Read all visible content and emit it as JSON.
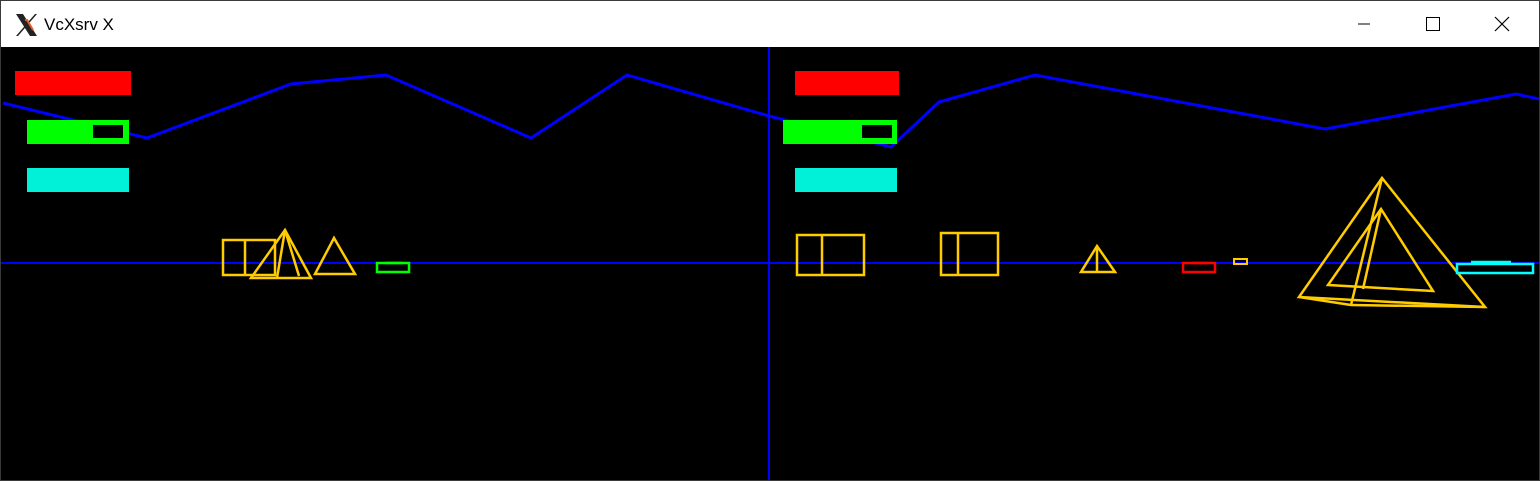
{
  "window": {
    "title": "VcXsrv X",
    "icon": "x-logo-icon",
    "controls": [
      "minimize-icon",
      "maximize-icon",
      "close-icon"
    ]
  },
  "colors": {
    "titlebar_bg": "#ffffff",
    "viewport_bg": "#000000",
    "horizon": "#0000ff",
    "mountains": "#0000ff",
    "objects": "#ffcc00",
    "bar_red": "#ff0000",
    "bar_green": "#00ff00",
    "bar_cyan": "#00f0d8",
    "player_tank_left": "#00ff00",
    "enemy_tank_right": "#ff0000",
    "tank_far_right": "#00ffff"
  },
  "game": {
    "views": 2,
    "hud_bars_per_view": [
      "red",
      "green",
      "cyan"
    ],
    "objects_left": [
      "cube",
      "pyramid",
      "pyramid",
      "tank-green"
    ],
    "objects_right": [
      "cube",
      "cube",
      "pyramid",
      "tank-red",
      "saucer",
      "pyramid-large",
      "tank-cyan"
    ]
  }
}
